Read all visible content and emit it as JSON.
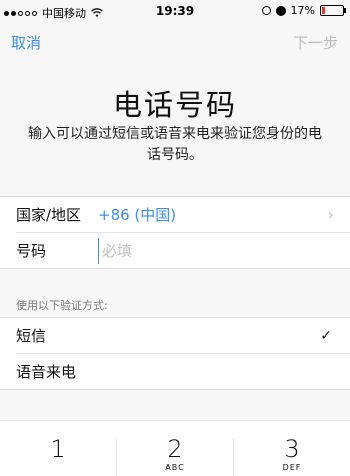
{
  "status": {
    "carrier": "中国移动",
    "time": "19:39",
    "battery": "17%",
    "battery_level": 0.17,
    "signal_icon": "signal-dots",
    "wifi_icon": "wifi-icon"
  },
  "nav": {
    "cancel": "取消",
    "next": "下一步"
  },
  "page": {
    "title": "电话号码",
    "subtitle": "输入可以通过短信或语音来电来验证您身份的电话号码。"
  },
  "form": {
    "country_label": "国家/地区",
    "country_value": "+86 (中国)",
    "number_label": "号码",
    "number_placeholder": "必填"
  },
  "verify": {
    "header": "使用以下验证方式:",
    "sms": "短信",
    "voice": "语音来电",
    "check": "✓"
  },
  "keypad": {
    "keys": [
      {
        "num": "1",
        "letters": ""
      },
      {
        "num": "2",
        "letters": "ABC"
      },
      {
        "num": "3",
        "letters": "DEF"
      }
    ]
  },
  "colors": {
    "accent": "#3d8fe6",
    "disabled": "#bdbdbd",
    "battery": "#e53935"
  }
}
